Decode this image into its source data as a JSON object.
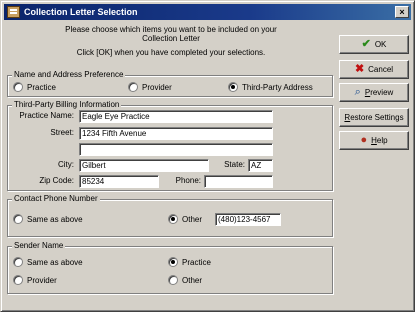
{
  "window": {
    "title": "Collection Letter Selection",
    "close_glyph": "×"
  },
  "instructions": {
    "line1": "Please choose which items you want to be included on your",
    "line2": "Collection Letter",
    "line3": "Click [OK] when you have completed your selections."
  },
  "buttons": {
    "ok": "OK",
    "cancel": "Cancel",
    "preview_u": "P",
    "preview_rest": "review",
    "restore_u": "R",
    "restore_rest": "estore Settings",
    "help_u": "H",
    "help_rest": "elp"
  },
  "name_address": {
    "title": "Name and Address Preference",
    "options": [
      "Practice",
      "Provider",
      "Third-Party Address"
    ],
    "selected": "Third-Party Address"
  },
  "billing": {
    "title": "Third-Party Billing Information",
    "practice_name_label": "Practice Name:",
    "practice_name": "Eagle Eye Practice",
    "street_label": "Street:",
    "street1": "1234 Fifth Avenue",
    "street2": "",
    "city_label": "City:",
    "city": "Gilbert",
    "state_label": "State:",
    "state": "AZ",
    "zip_label": "Zip Code:",
    "zip": "85234",
    "phone_label": "Phone:",
    "phone": ""
  },
  "contact_phone": {
    "title": "Contact Phone Number",
    "same_label": "Same as above",
    "other_label": "Other",
    "other_value": "(480)123-4567",
    "selected": "Other"
  },
  "sender": {
    "title": "Sender Name",
    "options": [
      "Same as above",
      "Practice",
      "Provider",
      "Other"
    ],
    "selected": "Practice"
  },
  "icons": {
    "ok": "checkmark-icon",
    "cancel": "x-icon",
    "preview": "magnifier-icon",
    "help": "help-icon"
  },
  "colors": {
    "titlebar": "#0a246a",
    "face": "#d4d0c8"
  }
}
